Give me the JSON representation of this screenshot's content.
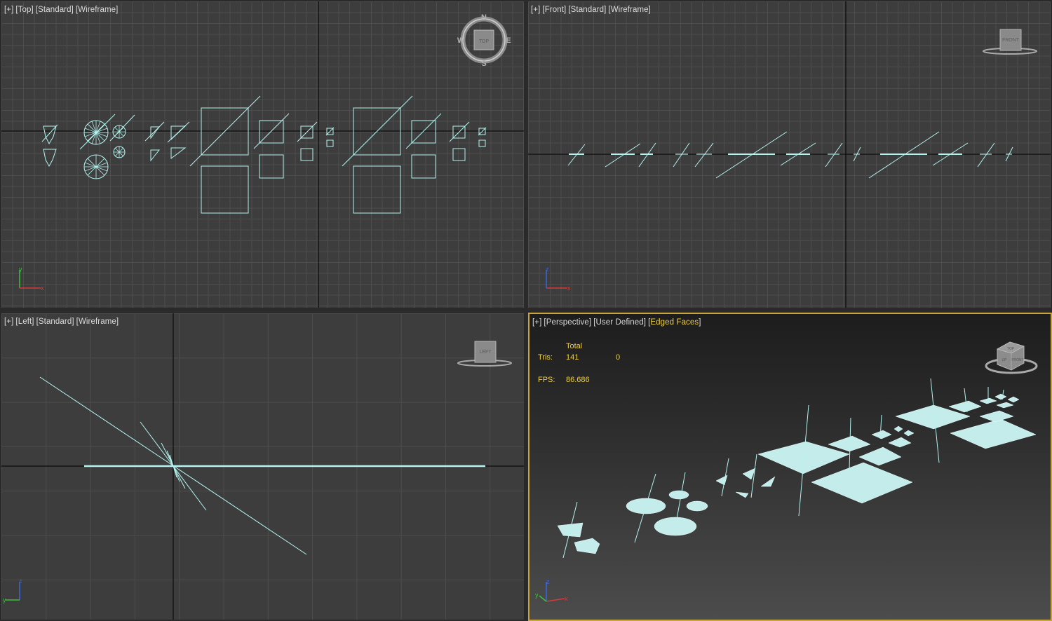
{
  "viewports": {
    "top": {
      "label": [
        "[+]",
        "[Top]",
        "[Standard]",
        "[Wireframe]"
      ],
      "viewcube_face": "TOP",
      "compass": {
        "n": "N",
        "s": "S",
        "e": "E",
        "w": "W"
      }
    },
    "front": {
      "label": [
        "[+]",
        "[Front]",
        "[Standard]",
        "[Wireframe]"
      ],
      "viewcube_face": "FRONT"
    },
    "left": {
      "label": [
        "[+]",
        "[Left]",
        "[Standard]",
        "[Wireframe]"
      ],
      "viewcube_face": "LEFT"
    },
    "perspective": {
      "label": [
        "[+]",
        "[Perspective]",
        "[User Defined]"
      ],
      "label_highlight_prefix": "[",
      "label_highlight": "Edged Faces",
      "label_highlight_suffix": "]",
      "viewcube_faces": [
        "TOP",
        "UP",
        "FRONT"
      ],
      "stats": {
        "header": "Total",
        "tris_label": "Tris:",
        "tris_total": "141",
        "tris_selected": "0",
        "fps_label": "FPS:",
        "fps_value": "86.686"
      }
    }
  },
  "axis_labels": {
    "x": "x",
    "y": "y",
    "z": "z"
  },
  "colors": {
    "active_border": "#c9a33c",
    "wire": "#b4f4f0",
    "stats": "#f0d040",
    "axis_x": "#d63a3a",
    "axis_y": "#3ac23a",
    "axis_z": "#3a66e0"
  },
  "icons": [
    "viewcube-icon",
    "compass-icon",
    "axis-tripod-icon"
  ]
}
